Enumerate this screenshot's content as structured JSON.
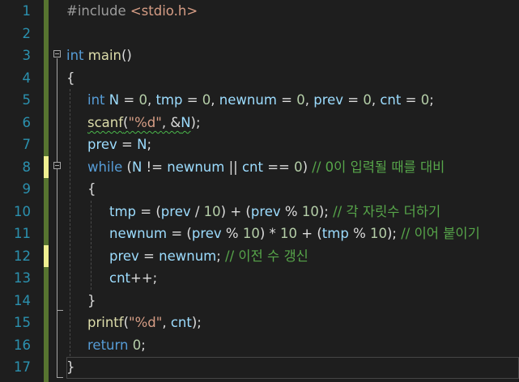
{
  "editor": {
    "line_numbers": [
      "1",
      "2",
      "3",
      "4",
      "5",
      "6",
      "7",
      "8",
      "9",
      "10",
      "11",
      "12",
      "13",
      "14",
      "15",
      "16",
      "17"
    ],
    "lines": {
      "l1": {
        "directive": "#include",
        "header": "<stdio.h>"
      },
      "l3": {
        "type": "int",
        "name": "main",
        "rest": "()"
      },
      "l4": {
        "brace": "{"
      },
      "l5": {
        "type": "int",
        "a": "N",
        "b": " = ",
        "c": "0",
        ", ": ", ",
        "d": "tmp",
        "e": "0",
        "f": "newnum",
        "g": "0",
        "h": "prev",
        "i": "0",
        "j": "cnt",
        "k": "0",
        "end": ";"
      },
      "l6": {
        "fn": "scanf",
        "open": "(",
        "str": "\"%d\"",
        "mid": ", &",
        "var": "N",
        "close": ");"
      },
      "l7": {
        "var1": "prev",
        "op": " = ",
        "var2": "N",
        "end": ";"
      },
      "l8": {
        "kw": "while",
        "open": " (",
        "v1": "N",
        "op1": " != ",
        "v2": "newnum",
        "op2": " || ",
        "v3": "cnt",
        "op3": " == ",
        "num": "0",
        "close": ") ",
        "comment": "// 0이 입력될 때를 대비"
      },
      "l9": {
        "brace": "{"
      },
      "l10": {
        "v1": "tmp",
        "a": " = (",
        "v2": "prev",
        "b": " / ",
        "n1": "10",
        "c": ") + (",
        "v3": "prev",
        "d": " % ",
        "n2": "10",
        "e": "); ",
        "comment": "// 각 자릿수 더하기"
      },
      "l11": {
        "v1": "newnum",
        "a": " = (",
        "v2": "prev",
        "b": " % ",
        "n1": "10",
        "c": ") * ",
        "n2": "10",
        "d": " + (",
        "v3": "tmp",
        "e": " % ",
        "n3": "10",
        "f": "); ",
        "comment": "// 이어 붙이기"
      },
      "l12": {
        "v1": "prev",
        "a": " = ",
        "v2": "newnum",
        "b": "; ",
        "comment": "// 이전 수 갱신"
      },
      "l13": {
        "v1": "cnt",
        "a": "++;"
      },
      "l14": {
        "brace": "}"
      },
      "l15": {
        "fn": "printf",
        "open": "(",
        "str": "\"%d\"",
        "mid": ", ",
        "var": "cnt",
        "close": ");"
      },
      "l16": {
        "kw": "return",
        "sp": " ",
        "num": "0",
        "end": ";"
      },
      "l17": {
        "brace": "}"
      }
    }
  },
  "colors": {
    "background": "#1e1e1e",
    "line_number": "#2b91af",
    "keyword": "#569cd6",
    "function": "#dcdcaa",
    "variable": "#9cdcfe",
    "string": "#d69d85",
    "number": "#b5cea8",
    "comment": "#57a64a",
    "saved_change": "#577430",
    "unsaved_change": "#efef91"
  }
}
